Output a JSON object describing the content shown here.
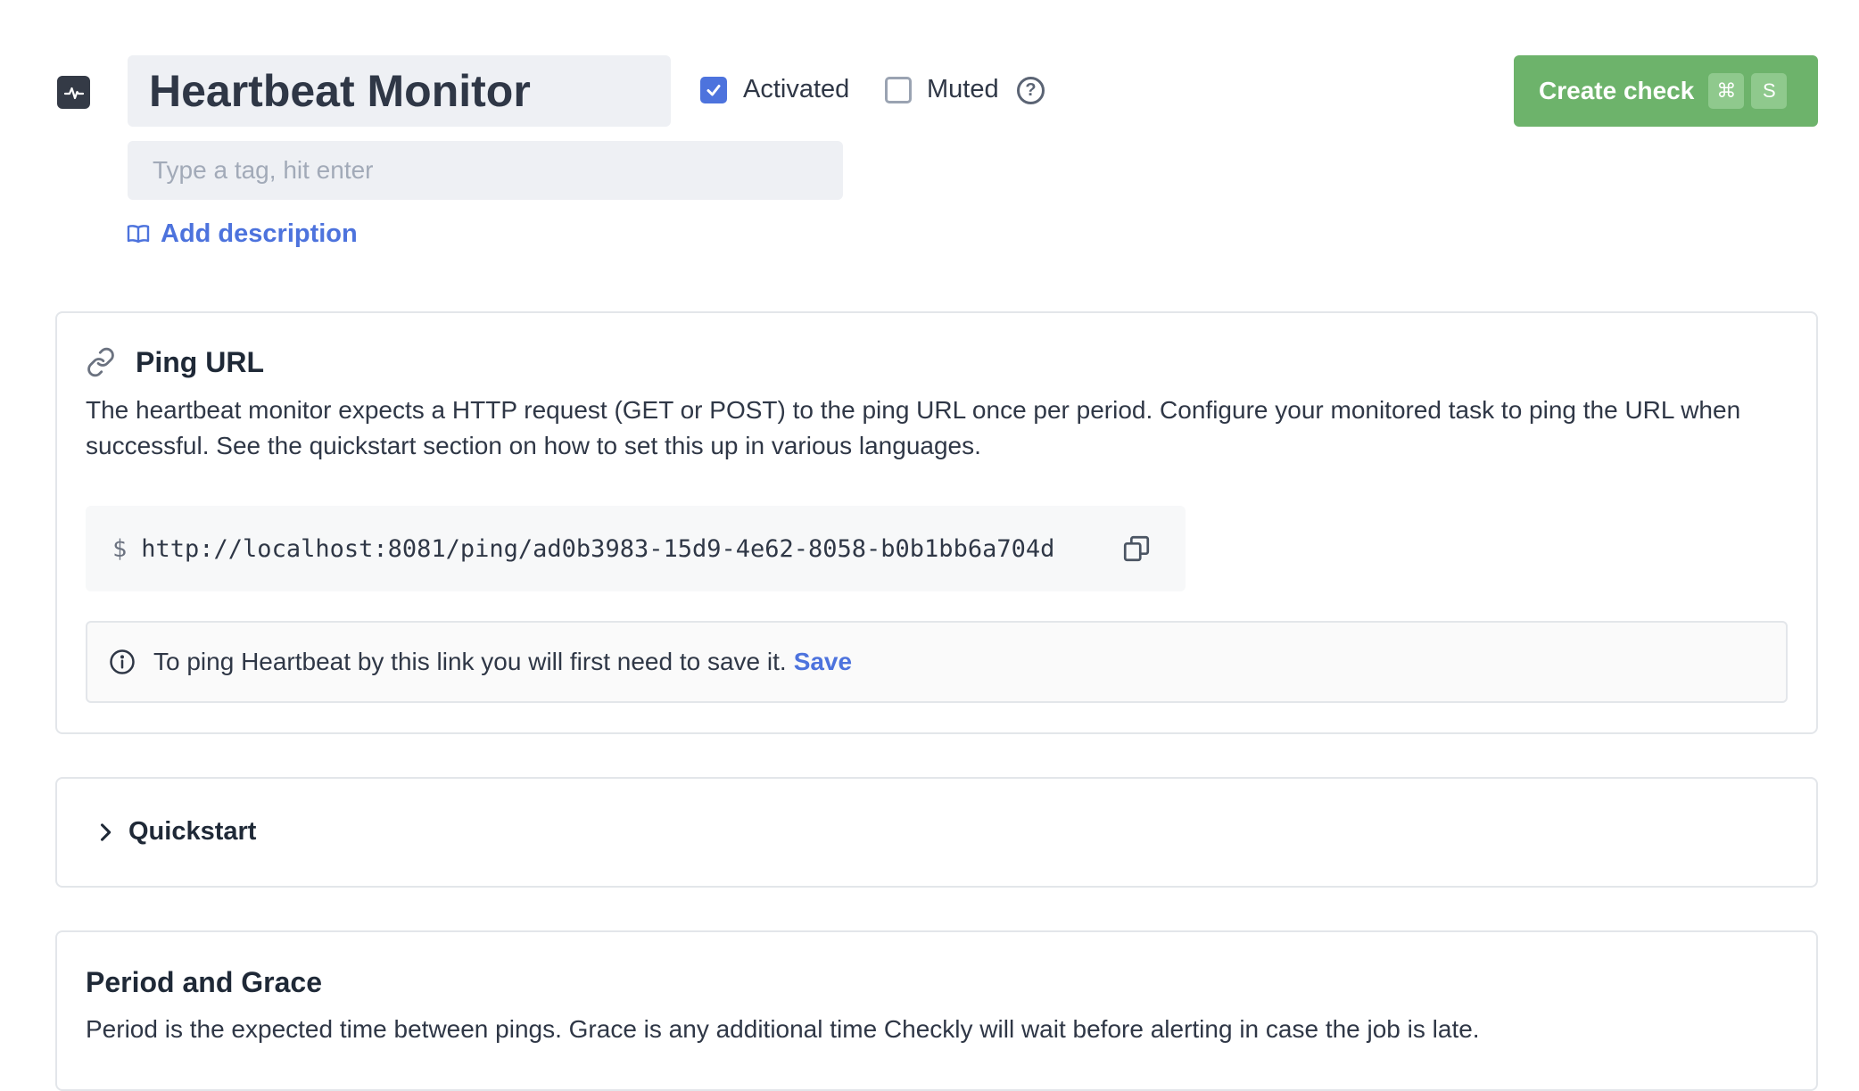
{
  "header": {
    "type_icon": "heartbeat-pulse-icon",
    "check_name": "Heartbeat Monitor",
    "activated": {
      "label": "Activated",
      "checked": true
    },
    "muted": {
      "label": "Muted",
      "checked": false
    },
    "help_icon": "question-circle-icon",
    "create_button": {
      "label": "Create check",
      "shortcut": [
        "⌘",
        "S"
      ]
    }
  },
  "tags": {
    "placeholder": "Type a tag, hit enter"
  },
  "description": {
    "link_label": "Add description",
    "icon": "book-open-icon"
  },
  "ping_url": {
    "title": "Ping URL",
    "icon": "link-icon",
    "description": "The heartbeat monitor expects a HTTP request (GET or POST) to the ping URL once per period. Configure your monitored task to ping the URL when successful. See the quickstart section on how to set this up in various languages.",
    "prompt": "$",
    "url": "http://localhost:8081/ping/ad0b3983-15d9-4e62-8058-b0b1bb6a704d",
    "copy_icon": "copy-icon",
    "notice": {
      "icon": "info-circle-icon",
      "text": "To ping Heartbeat by this link you will first need to save it.",
      "save_label": "Save"
    }
  },
  "quickstart": {
    "title": "Quickstart",
    "icon": "chevron-right-icon",
    "expanded": false
  },
  "period_grace": {
    "title": "Period and Grace",
    "description": "Period is the expected time between pings. Grace is any additional time Checkly will wait before alerting in case the job is late."
  },
  "colors": {
    "accent": "#4d73dd",
    "create_button": "#6db36b",
    "input_bg": "#eef0f4",
    "border": "#e3e6ea"
  }
}
